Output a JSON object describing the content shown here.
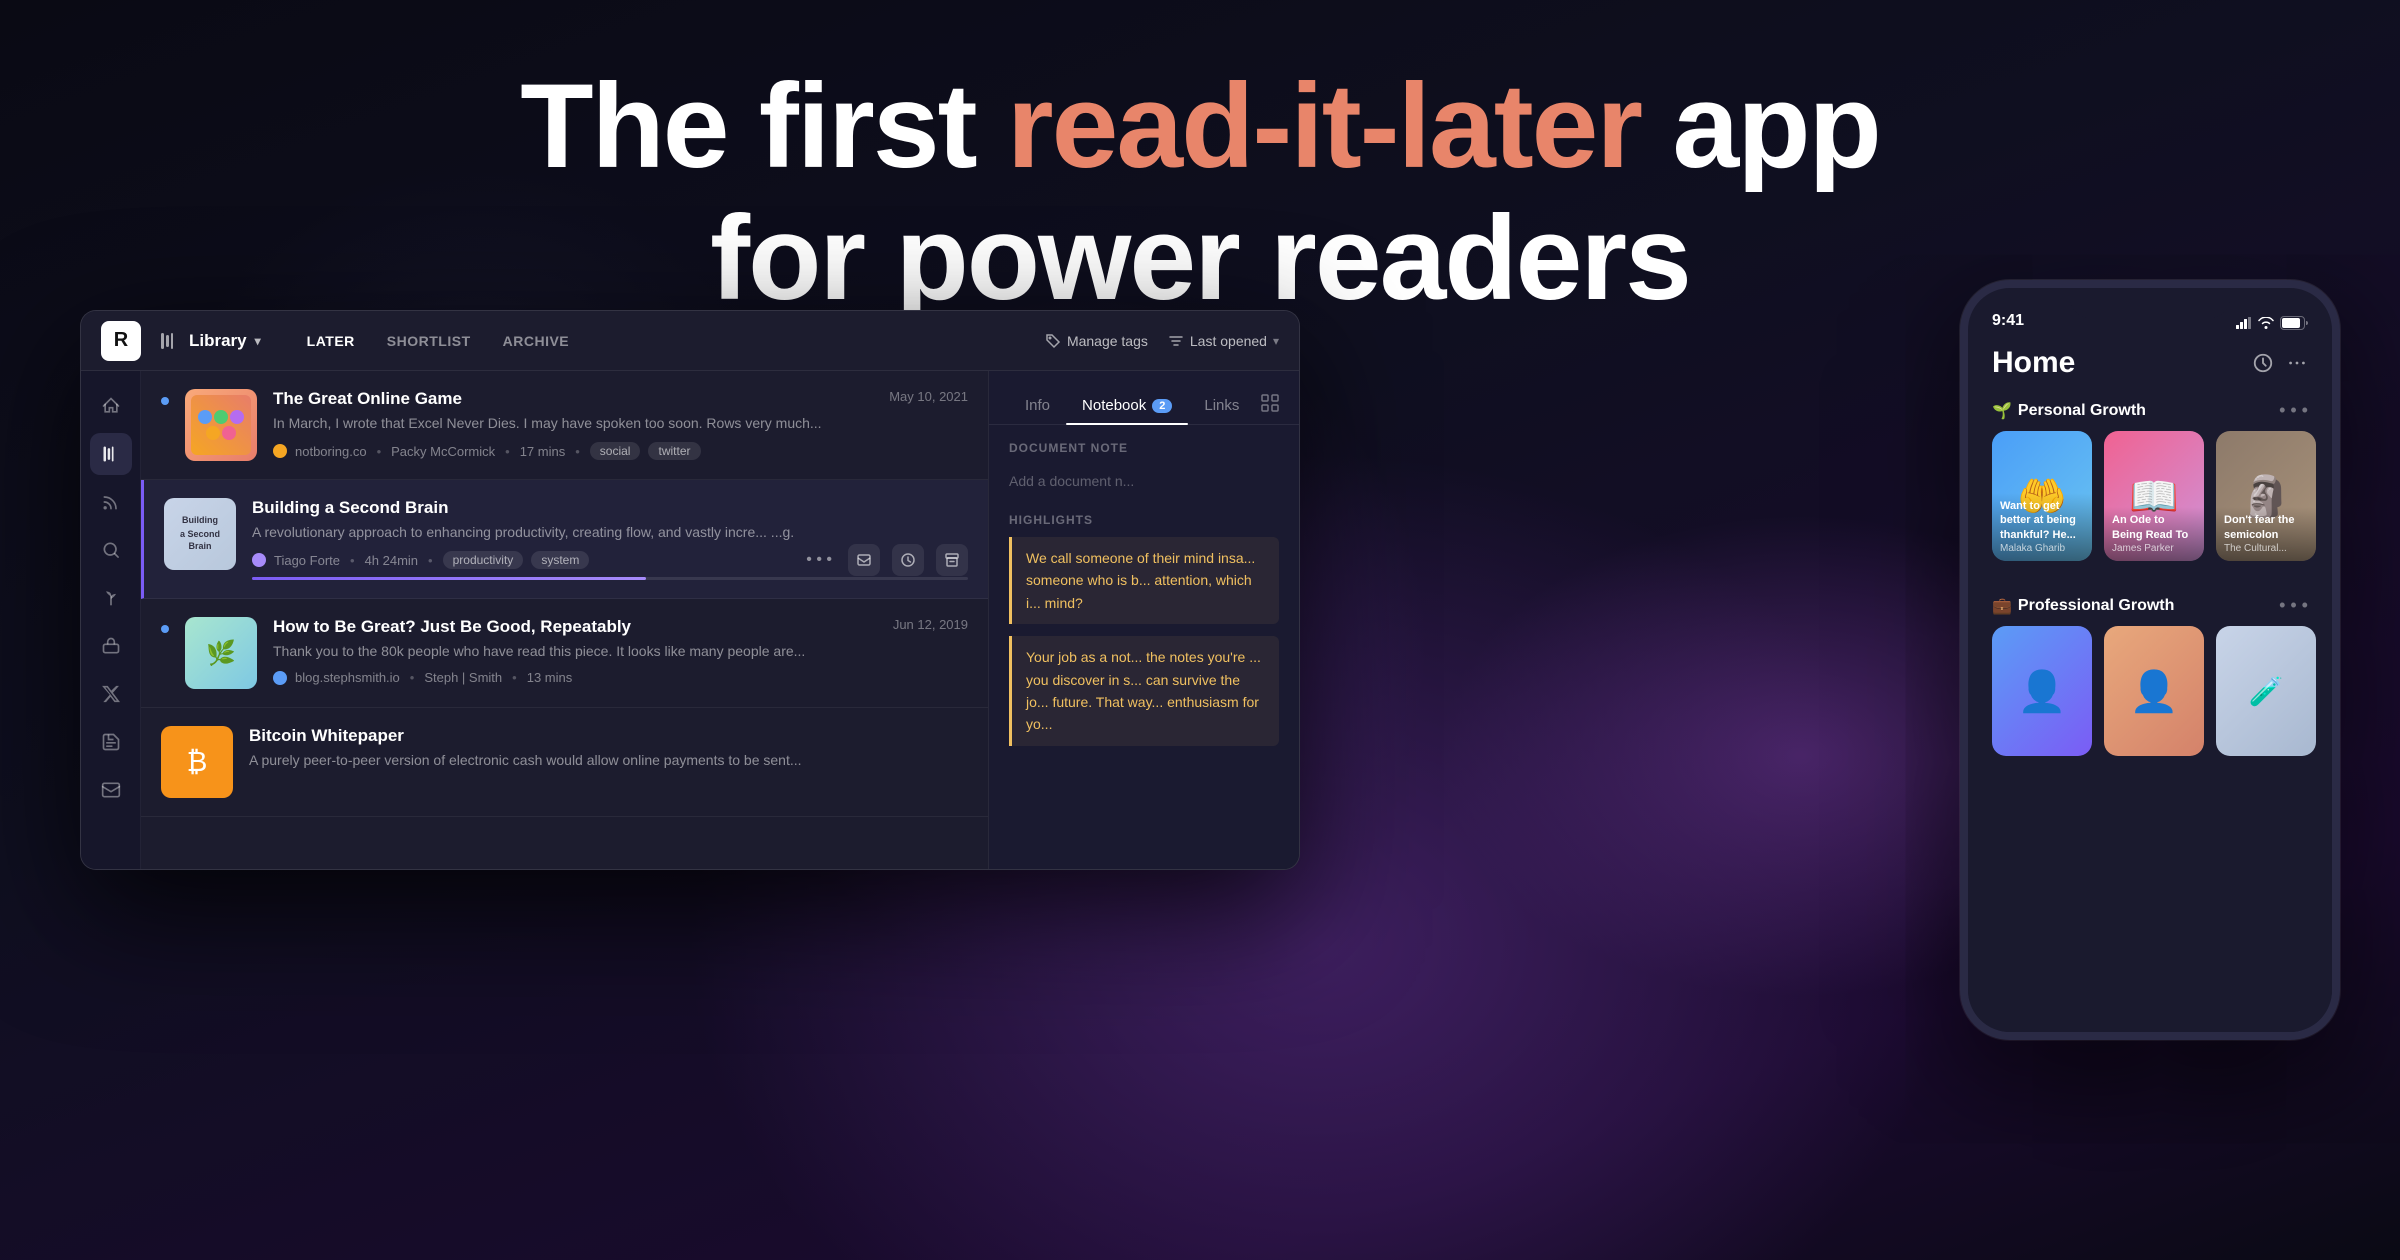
{
  "hero": {
    "line1_plain": "The first ",
    "line1_accent": "read-it-later",
    "line1_end": " app",
    "line2": "for power readers"
  },
  "window": {
    "logo": "R",
    "nav_library": "Library",
    "tabs": [
      {
        "label": "LATER",
        "active": true
      },
      {
        "label": "SHORTLIST",
        "active": false
      },
      {
        "label": "ARCHIVE",
        "active": false
      }
    ],
    "manage_tags": "Manage tags",
    "last_opened": "Last opened",
    "right_tabs": [
      {
        "label": "Info",
        "active": false
      },
      {
        "label": "Notebook",
        "active": true,
        "badge": "2"
      },
      {
        "label": "Links",
        "active": false
      }
    ],
    "document_note_label": "DOCUMENT NOTE",
    "document_note_placeholder": "Add a document n...",
    "highlights_label": "HIGHLIGHTS",
    "highlights": [
      "We call someone of their mind insa... someone who is b... attention, which i... mind?",
      "Your job as a not... the notes you're ... you discover in s... can survive the jo... future. That way... enthusiasm for yo..."
    ]
  },
  "articles": [
    {
      "id": "great-online-game",
      "title": "The Great Online Game",
      "excerpt": "In March, I wrote that Excel Never Dies. I may have spoken too soon. Rows very much...",
      "date": "May 10, 2021",
      "source_icon": "notboring",
      "source": "notboring.co",
      "author": "Packy McCormick",
      "read_time": "17 mins",
      "tags": [
        "social",
        "twitter"
      ],
      "selected": false,
      "has_dot": true
    },
    {
      "id": "building-second-brain",
      "title": "Building a Second Brain",
      "excerpt": "A revolutionary approach to enhancing productivity, creating flow, and vastly incre... ...g.",
      "date": "",
      "source_icon": "tiago",
      "source": "Tiago Forte",
      "author": "",
      "read_time": "4h 24min",
      "tags": [
        "productivity",
        "system"
      ],
      "selected": true,
      "has_dot": false,
      "progress": 55
    },
    {
      "id": "how-to-be-great",
      "title": "How to Be Great? Just Be Good, Repeatably",
      "excerpt": "Thank you to the 80k people who have read this piece. It looks like many people are...",
      "date": "Jun 12, 2019",
      "source_icon": "steph",
      "source": "blog.stephsmith.io",
      "author": "Steph | Smith",
      "read_time": "13 mins",
      "tags": [],
      "selected": false,
      "has_dot": true
    },
    {
      "id": "bitcoin-whitepaper",
      "title": "Bitcoin Whitepaper",
      "excerpt": "A purely peer-to-peer version of electronic cash would allow online payments to be sent...",
      "date": "",
      "source_icon": "bitcoin",
      "source": "",
      "author": "",
      "read_time": "",
      "tags": [],
      "selected": false,
      "has_dot": false
    }
  ],
  "phone": {
    "time": "9:41",
    "home_title": "Home",
    "sections": [
      {
        "emoji": "🌱",
        "title": "Personal Growth",
        "cards": [
          {
            "type": "blue",
            "label": "Want to get better at being thankful? He...",
            "author": "Malaka Gharib"
          },
          {
            "type": "pink",
            "label": "An Ode to Being Read To",
            "author": "James Parker"
          },
          {
            "type": "stone",
            "label": "Don't fear the semicolon",
            "author": "The Cultural..."
          }
        ]
      },
      {
        "emoji": "💼",
        "title": "Professional Growth",
        "cards": []
      }
    ]
  },
  "sidebar_icons": [
    {
      "name": "home",
      "symbol": "⌂",
      "active": false
    },
    {
      "name": "library",
      "symbol": "≡",
      "active": true
    },
    {
      "name": "feed",
      "symbol": "◎",
      "active": false
    },
    {
      "name": "search",
      "symbol": "⌕",
      "active": false
    },
    {
      "name": "growth",
      "symbol": "✦",
      "active": false
    },
    {
      "name": "toolbox",
      "symbol": "▭",
      "active": false
    },
    {
      "name": "twitter",
      "symbol": "𝕏",
      "active": false
    },
    {
      "name": "document",
      "symbol": "☰",
      "active": false
    },
    {
      "name": "mail",
      "symbol": "✉",
      "active": false
    }
  ]
}
